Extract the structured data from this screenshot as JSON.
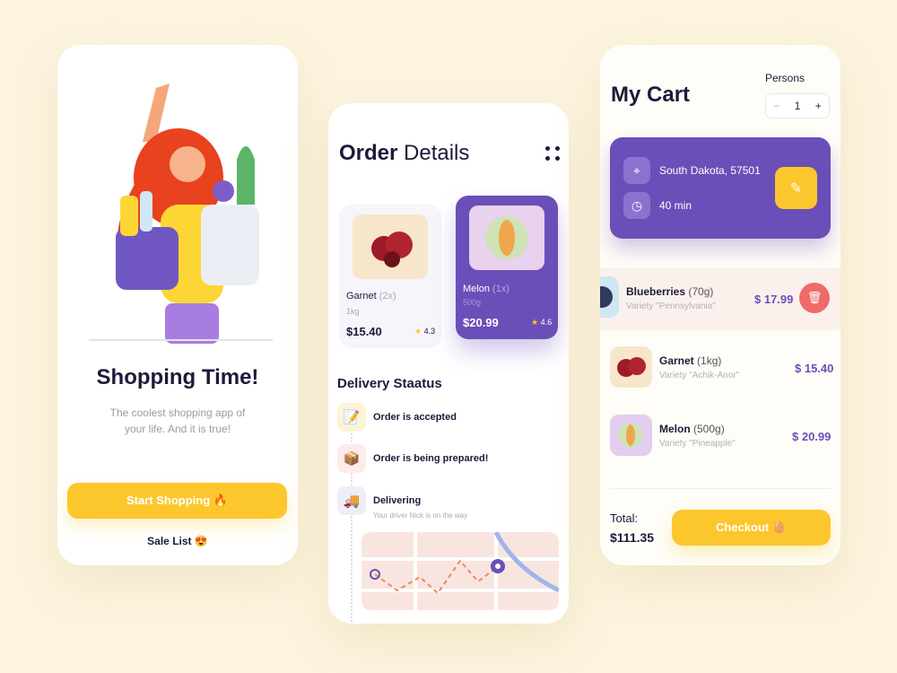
{
  "welcome": {
    "title": "Shopping Time!",
    "subtitle_line1": "The coolest shopping app of",
    "subtitle_line2": "your life. And it is true!",
    "start_button": "Start Shopping 🔥",
    "sale_link": "Sale List 😍"
  },
  "order": {
    "title_bold": "Order",
    "title_rest": " Details",
    "menu_icon": "dots-grid-icon",
    "products": [
      {
        "name": "Garnet",
        "qty": "(2x)",
        "weight": "1kg",
        "price": "$15.40",
        "rating": "4.3"
      },
      {
        "name": "Melon",
        "qty": "(1x)",
        "weight": "500g",
        "price": "$20.99",
        "rating": "4.6"
      }
    ],
    "status_title": "Delivery Staatus",
    "steps": [
      {
        "label": "Order is accepted",
        "icon": "📝"
      },
      {
        "label": "Order is being prepared!",
        "icon": "📦"
      },
      {
        "label": "Delivering",
        "sub": "Your driver Nick is on the way",
        "icon": "🚚"
      }
    ]
  },
  "cart": {
    "title": "My Cart",
    "persons_label": "Persons",
    "persons_value": "1",
    "minus": "−",
    "plus": "+",
    "address": "South Dakota, 57501",
    "time": "40 min",
    "items": [
      {
        "name": "Blueberries",
        "qty": "(70g)",
        "variety": "Variety \"Pennsylvania\"",
        "price": "$ 17.99"
      },
      {
        "name": "Garnet",
        "qty": "(1kg)",
        "variety": "Variety \"Achik-Anor\"",
        "price": "$ 15.40"
      },
      {
        "name": "Melon",
        "qty": "(500g)",
        "variety": "Variety \"Pineapple\"",
        "price": "$ 20.99"
      }
    ],
    "total_label": "Total:",
    "total_value": "$111.35",
    "checkout": "Checkout 🥚"
  },
  "colors": {
    "accent_purple": "#6a4fb8",
    "accent_yellow": "#fcc72c",
    "delete_red": "#ef6b6b",
    "background": "#fcf4df"
  }
}
